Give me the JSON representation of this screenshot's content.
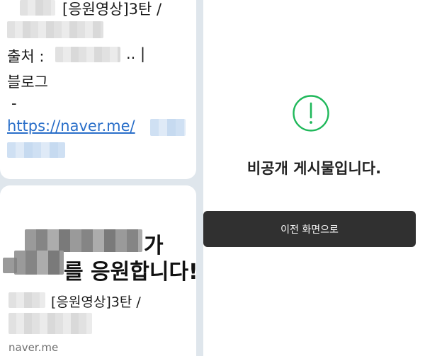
{
  "chat": {
    "message1": {
      "title_suffix": "[응원영상]3탄 /",
      "source_prefix": "출처 :",
      "source_suffix": ".. |",
      "blog_label": "블로그",
      "dash": "-",
      "link_text": "https://naver.me/"
    },
    "message2": {
      "banner_line1_suffix": "가",
      "banner_line2_suffix": "를 응원합니다!",
      "title_suffix": "[응원영상]3탄 /",
      "domain": "naver.me"
    }
  },
  "panel": {
    "headline": "비공개 게시물입니다.",
    "back_button_label": "이전 화면으로",
    "accent_color": "#1fb85a",
    "icon": "exclamation-circle-icon"
  }
}
